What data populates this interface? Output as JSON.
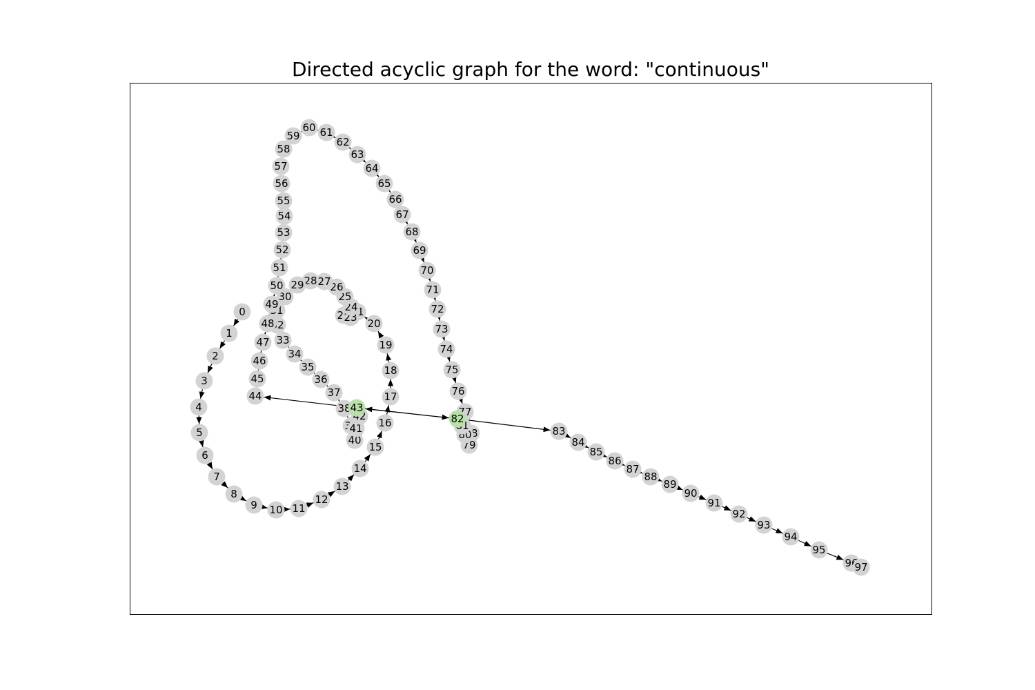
{
  "title": "Directed acyclic graph for the word: \"continuous\"",
  "colors": {
    "node_default": "#d3d3d3",
    "node_highlight": "#b8e0a8",
    "edge": "#000000",
    "frame": "#000000"
  },
  "nodes": [
    {
      "id": "0"
    },
    {
      "id": "1"
    },
    {
      "id": "2"
    },
    {
      "id": "3"
    },
    {
      "id": "4"
    },
    {
      "id": "5"
    },
    {
      "id": "6"
    },
    {
      "id": "7"
    },
    {
      "id": "8"
    },
    {
      "id": "9"
    },
    {
      "id": "10"
    },
    {
      "id": "11"
    },
    {
      "id": "12"
    },
    {
      "id": "13"
    },
    {
      "id": "14"
    },
    {
      "id": "15"
    },
    {
      "id": "16"
    },
    {
      "id": "17"
    },
    {
      "id": "18"
    },
    {
      "id": "19"
    },
    {
      "id": "20"
    },
    {
      "id": "21"
    },
    {
      "id": "22"
    },
    {
      "id": "23"
    },
    {
      "id": "24"
    },
    {
      "id": "25"
    },
    {
      "id": "26"
    },
    {
      "id": "27"
    },
    {
      "id": "28"
    },
    {
      "id": "29"
    },
    {
      "id": "30"
    },
    {
      "id": "31"
    },
    {
      "id": "32"
    },
    {
      "id": "33"
    },
    {
      "id": "34"
    },
    {
      "id": "35"
    },
    {
      "id": "36"
    },
    {
      "id": "37"
    },
    {
      "id": "38"
    },
    {
      "id": "39"
    },
    {
      "id": "40"
    },
    {
      "id": "41"
    },
    {
      "id": "42"
    },
    {
      "id": "43",
      "highlight": true
    },
    {
      "id": "44"
    },
    {
      "id": "45"
    },
    {
      "id": "46"
    },
    {
      "id": "47"
    },
    {
      "id": "48"
    },
    {
      "id": "49"
    },
    {
      "id": "50"
    },
    {
      "id": "51"
    },
    {
      "id": "52"
    },
    {
      "id": "53"
    },
    {
      "id": "54"
    },
    {
      "id": "55"
    },
    {
      "id": "56"
    },
    {
      "id": "57"
    },
    {
      "id": "58"
    },
    {
      "id": "59"
    },
    {
      "id": "60"
    },
    {
      "id": "61"
    },
    {
      "id": "62"
    },
    {
      "id": "63"
    },
    {
      "id": "64"
    },
    {
      "id": "65"
    },
    {
      "id": "66"
    },
    {
      "id": "67"
    },
    {
      "id": "68"
    },
    {
      "id": "69"
    },
    {
      "id": "70"
    },
    {
      "id": "71"
    },
    {
      "id": "72"
    },
    {
      "id": "73"
    },
    {
      "id": "74"
    },
    {
      "id": "75"
    },
    {
      "id": "76"
    },
    {
      "id": "77"
    },
    {
      "id": "78"
    },
    {
      "id": "79"
    },
    {
      "id": "80"
    },
    {
      "id": "81"
    },
    {
      "id": "82",
      "highlight": true
    },
    {
      "id": "83"
    },
    {
      "id": "84"
    },
    {
      "id": "85"
    },
    {
      "id": "86"
    },
    {
      "id": "87"
    },
    {
      "id": "88"
    },
    {
      "id": "89"
    },
    {
      "id": "90"
    },
    {
      "id": "91"
    },
    {
      "id": "92"
    },
    {
      "id": "93"
    },
    {
      "id": "94"
    },
    {
      "id": "95"
    },
    {
      "id": "96"
    },
    {
      "id": "97"
    }
  ],
  "edges": [
    [
      "0",
      "1"
    ],
    [
      "1",
      "2"
    ],
    [
      "2",
      "3"
    ],
    [
      "3",
      "4"
    ],
    [
      "4",
      "5"
    ],
    [
      "5",
      "6"
    ],
    [
      "6",
      "7"
    ],
    [
      "7",
      "8"
    ],
    [
      "8",
      "9"
    ],
    [
      "9",
      "10"
    ],
    [
      "10",
      "11"
    ],
    [
      "11",
      "12"
    ],
    [
      "12",
      "13"
    ],
    [
      "13",
      "14"
    ],
    [
      "14",
      "15"
    ],
    [
      "15",
      "16"
    ],
    [
      "16",
      "17"
    ],
    [
      "17",
      "18"
    ],
    [
      "18",
      "19"
    ],
    [
      "19",
      "20"
    ],
    [
      "20",
      "21"
    ],
    [
      "21",
      "22"
    ],
    [
      "22",
      "23"
    ],
    [
      "23",
      "24"
    ],
    [
      "24",
      "25"
    ],
    [
      "25",
      "26"
    ],
    [
      "26",
      "27"
    ],
    [
      "27",
      "28"
    ],
    [
      "28",
      "29"
    ],
    [
      "29",
      "30"
    ],
    [
      "30",
      "31"
    ],
    [
      "31",
      "32"
    ],
    [
      "32",
      "33"
    ],
    [
      "33",
      "34"
    ],
    [
      "34",
      "35"
    ],
    [
      "35",
      "36"
    ],
    [
      "36",
      "37"
    ],
    [
      "37",
      "38"
    ],
    [
      "38",
      "39"
    ],
    [
      "39",
      "40"
    ],
    [
      "40",
      "41"
    ],
    [
      "41",
      "42"
    ],
    [
      "42",
      "43"
    ],
    [
      "43",
      "44"
    ],
    [
      "44",
      "45"
    ],
    [
      "45",
      "46"
    ],
    [
      "46",
      "47"
    ],
    [
      "47",
      "48"
    ],
    [
      "48",
      "49"
    ],
    [
      "49",
      "50"
    ],
    [
      "50",
      "51"
    ],
    [
      "51",
      "52"
    ],
    [
      "52",
      "53"
    ],
    [
      "53",
      "54"
    ],
    [
      "54",
      "55"
    ],
    [
      "55",
      "56"
    ],
    [
      "56",
      "57"
    ],
    [
      "57",
      "58"
    ],
    [
      "58",
      "59"
    ],
    [
      "59",
      "60"
    ],
    [
      "60",
      "61"
    ],
    [
      "61",
      "62"
    ],
    [
      "62",
      "63"
    ],
    [
      "63",
      "64"
    ],
    [
      "64",
      "65"
    ],
    [
      "65",
      "66"
    ],
    [
      "66",
      "67"
    ],
    [
      "67",
      "68"
    ],
    [
      "68",
      "69"
    ],
    [
      "69",
      "70"
    ],
    [
      "70",
      "71"
    ],
    [
      "71",
      "72"
    ],
    [
      "72",
      "73"
    ],
    [
      "73",
      "74"
    ],
    [
      "74",
      "75"
    ],
    [
      "75",
      "76"
    ],
    [
      "76",
      "77"
    ],
    [
      "77",
      "78"
    ],
    [
      "78",
      "79"
    ],
    [
      "79",
      "80"
    ],
    [
      "80",
      "81"
    ],
    [
      "81",
      "82"
    ],
    [
      "82",
      "83"
    ],
    [
      "83",
      "84"
    ],
    [
      "84",
      "85"
    ],
    [
      "85",
      "86"
    ],
    [
      "86",
      "87"
    ],
    [
      "87",
      "88"
    ],
    [
      "88",
      "89"
    ],
    [
      "89",
      "90"
    ],
    [
      "90",
      "91"
    ],
    [
      "91",
      "92"
    ],
    [
      "92",
      "93"
    ],
    [
      "93",
      "94"
    ],
    [
      "94",
      "95"
    ],
    [
      "95",
      "96"
    ],
    [
      "96",
      "97"
    ],
    [
      "82",
      "43"
    ],
    [
      "43",
      "82"
    ]
  ]
}
